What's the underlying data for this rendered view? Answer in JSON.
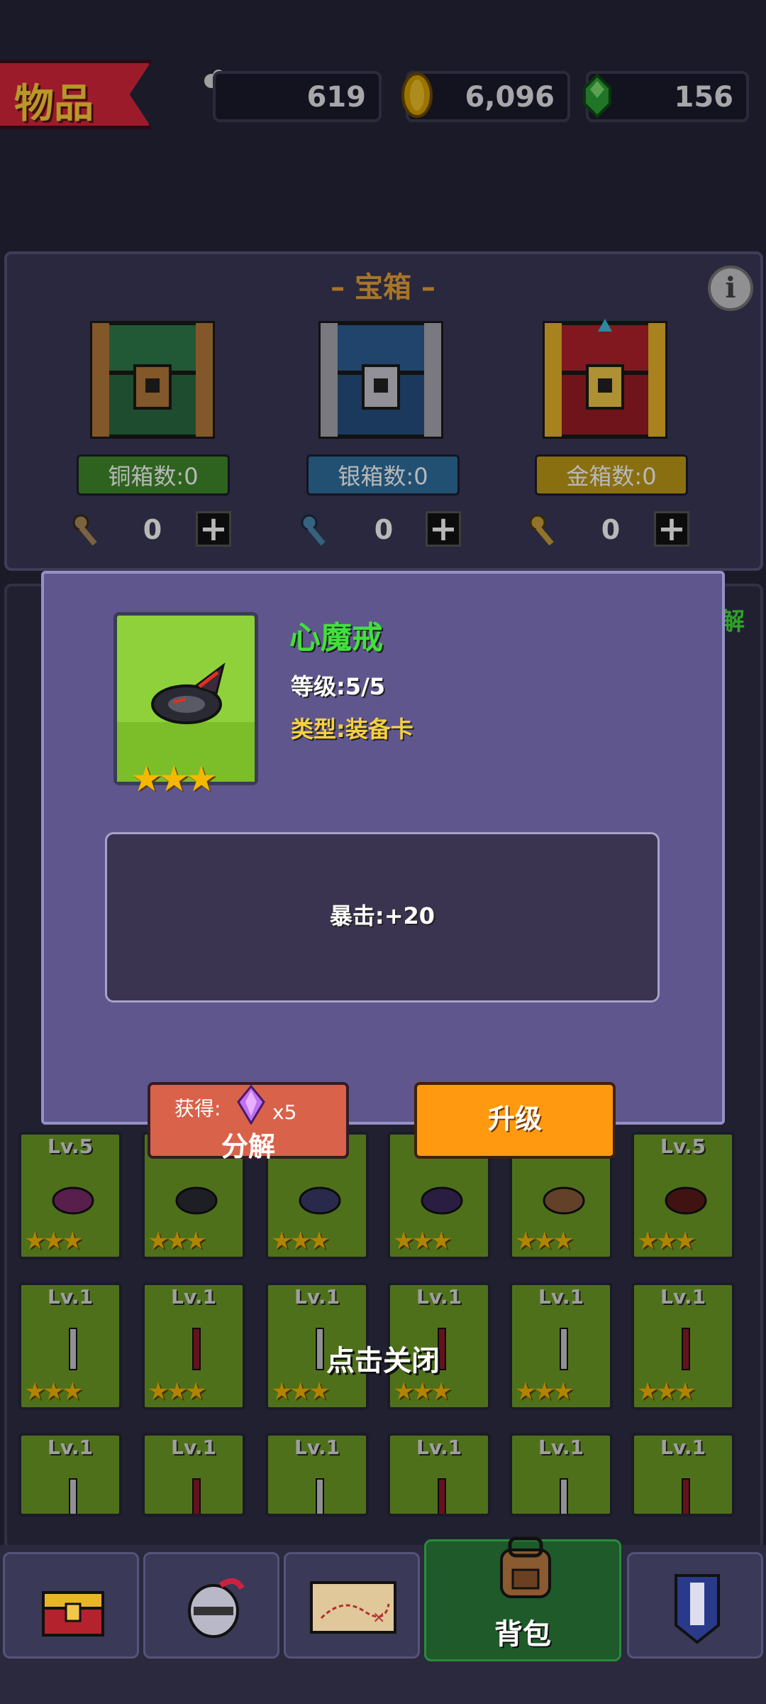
{
  "header": {
    "title": "物品",
    "bones": "619",
    "gold": "6,096",
    "gems": "156"
  },
  "chests": {
    "title": "– 宝箱 –",
    "info_symbol": "i",
    "items": [
      {
        "label": "铜箱数:0",
        "keys": "0"
      },
      {
        "label": "银箱数:0",
        "keys": "0"
      },
      {
        "label": "金箱数:0",
        "keys": "0"
      }
    ]
  },
  "grid": {
    "row1": [
      "Lv.5",
      "",
      "",
      "",
      "",
      "Lv.5"
    ],
    "row2": [
      "Lv.1",
      "Lv.1",
      "Lv.1",
      "Lv.1",
      "Lv.1",
      "Lv.1"
    ],
    "row3": [
      "Lv.1",
      "Lv.1",
      "Lv.1",
      "Lv.1",
      "Lv.1",
      "Lv.1"
    ],
    "stars": "★★★",
    "corner_text": "解"
  },
  "modal": {
    "item_name": "心魔戒",
    "level": "等级:5/5",
    "type": "类型:装备卡",
    "stars": "★★★",
    "stat": "暴击:+20",
    "decompose": {
      "gain_label": "获得:",
      "qty": "x5",
      "label": "分解"
    },
    "upgrade_label": "升级",
    "close_hint": "点击关闭"
  },
  "nav": {
    "active_label": "背包"
  },
  "colors": {
    "panel": "#3a3857",
    "modal": "#5f568e",
    "card_green": "#6e9b26",
    "gold_text": "#e8a23a",
    "name_green": "#43e03b"
  }
}
